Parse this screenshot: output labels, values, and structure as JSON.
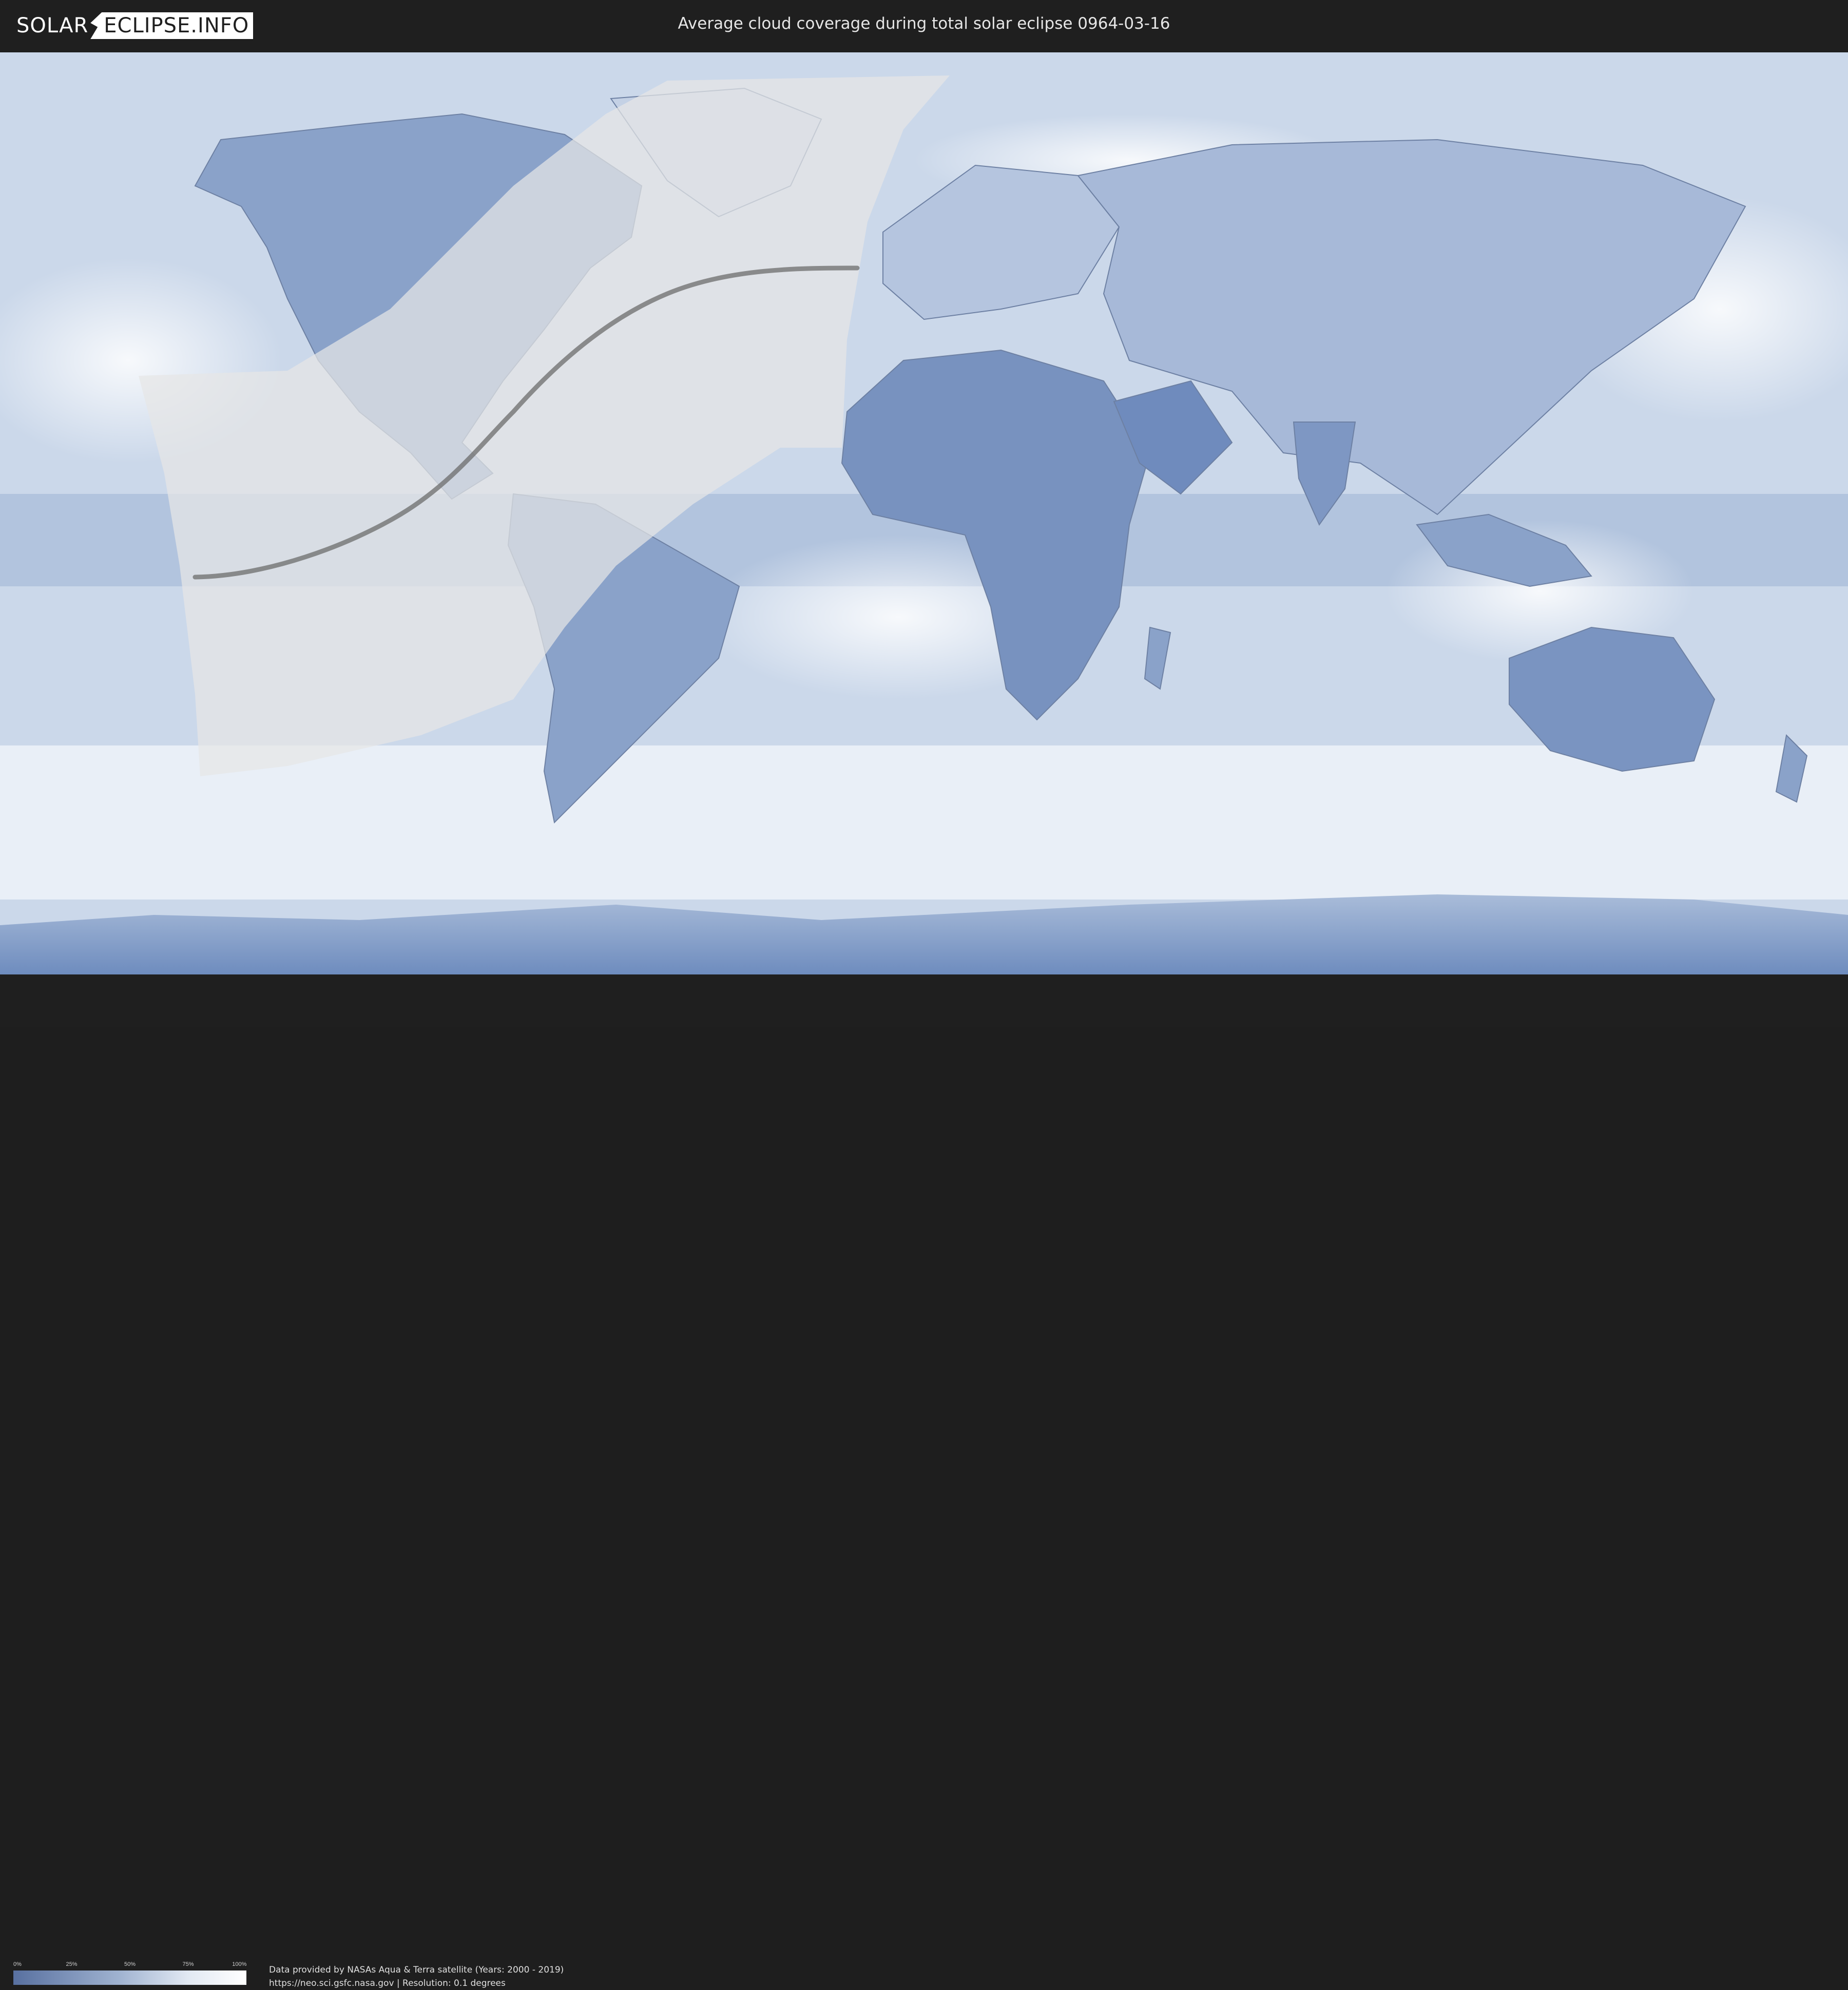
{
  "header": {
    "logo_left": "SOLAR",
    "logo_right": "ECLIPSE.INFO",
    "title": "Average cloud coverage during total solar eclipse 0964-03-16"
  },
  "legend": {
    "ticks": [
      "0%",
      "25%",
      "50%",
      "75%",
      "100%"
    ],
    "colors": {
      "low": "#5870a0",
      "high": "#ffffff"
    }
  },
  "footer": {
    "line1": "Data provided by NASAs Aqua & Terra satellite (Years: 2000 - 2019)",
    "line2": "https://neo.sci.gsfc.nasa.gov | Resolution: 0.1 degrees"
  },
  "map": {
    "projection": "equirectangular",
    "ocean_color": "#c9d6e8",
    "land_color": "#7d97c2",
    "overlay_color": "#e4e4e4"
  }
}
